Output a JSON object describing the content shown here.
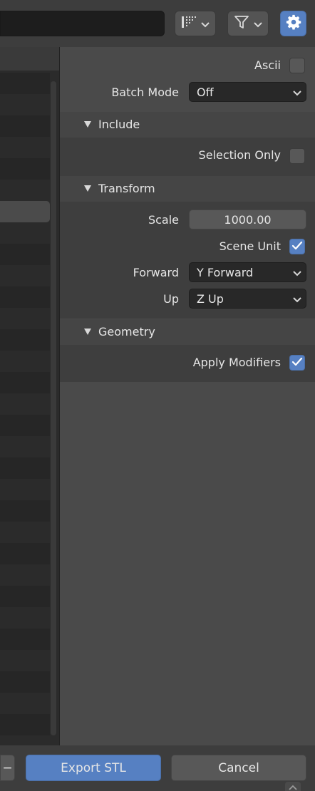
{
  "header": {
    "display_mode_icon": "list-display-icon",
    "filter_icon": "filter-icon",
    "settings_icon": "gear-icon"
  },
  "file_list": {
    "row_count": 31,
    "selected_row_index": 6
  },
  "properties": {
    "ascii": {
      "label": "Ascii",
      "checked": false
    },
    "batch_mode": {
      "label": "Batch Mode",
      "value": "Off"
    },
    "include": {
      "title": "Include",
      "selection_only": {
        "label": "Selection Only",
        "checked": false
      }
    },
    "transform": {
      "title": "Transform",
      "scale": {
        "label": "Scale",
        "value": "1000.00"
      },
      "scene_unit": {
        "label": "Scene Unit",
        "checked": true
      },
      "forward": {
        "label": "Forward",
        "value": "Y Forward"
      },
      "up": {
        "label": "Up",
        "value": "Z Up"
      }
    },
    "geometry": {
      "title": "Geometry",
      "apply_modifiers": {
        "label": "Apply Modifiers",
        "checked": true
      }
    }
  },
  "footer": {
    "minus_label": "−",
    "export_label": "Export STL",
    "cancel_label": "Cancel"
  },
  "colors": {
    "accent": "#5680c2",
    "panel_bg": "#4a4a4a",
    "section_bg": "#3e3e3e",
    "field_bg": "#282828"
  }
}
